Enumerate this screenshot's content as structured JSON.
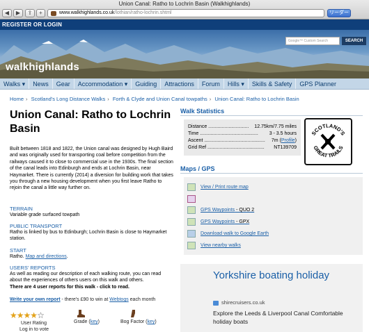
{
  "browser": {
    "title": "Union Canal: Ratho to Lochrin Basin (Walkhighlands)",
    "url_host": "www.walkhighlands.co.uk",
    "url_path": "/lothian/ratho-lochrin.shtml",
    "reader_label": "リーダー",
    "plus_label": "+"
  },
  "header": {
    "register_login": "REGISTER OR LOGIN",
    "logo": "walkhighlands",
    "search_placeholder": "Google™ Custom Search",
    "search_button": "SEARCH"
  },
  "nav": {
    "items": [
      "Walks ▾",
      "News",
      "Gear",
      "Accommodation ▾",
      "Guiding",
      "Attractions",
      "Forum",
      "Hills ▾",
      "Skills & Safety",
      "GPS Planner"
    ]
  },
  "breadcrumb": [
    "Home",
    "Scotland's Long Distance Walks",
    "Forth & Clyde and Union Canal towpaths",
    "Union Canal: Ratho to Lochrin Basin"
  ],
  "main": {
    "title": "Union Canal: Ratho to Lochrin Basin",
    "intro": "Built between 1818 and 1822, the Union canal was designed by Hugh Baird and was originally used for transporting coal before competition from the railways caused it to close to commercial use in the 1930s. The final section of the canal leads into Edinburgh and ends at Lochrin Basin, near Haymarket. There is currently (2014) a diversion for building work that takes you through a new housing development when you first leave Ratho to rejoin the canal a little way further on.",
    "terrain_head": "TERRAIN",
    "terrain_text": "Variable grade surfaced towpath",
    "transport_head": "PUBLIC TRANSPORT",
    "transport_text": "Ratho is linked by bus to Edinburgh; Lochrin Basin is close to Haymarket station.",
    "start_head": "START",
    "start_text": "Ratho.",
    "start_link": "Map and directions",
    "start_end": ".",
    "reports_head": "USERS' REPORTS",
    "reports_text": "As well as reading our description of each walking route, you can read about the experiences of others users on this walk and others.",
    "reports_bold": "There are 4 user reports for this walk - click to read.",
    "write_link": "Write your own report",
    "write_mid": " - there's £90 to win at ",
    "write_webtogs": "Webtogs",
    "write_end": " each month",
    "rating_label": "User Rating",
    "login_label": "Log in to vote",
    "grade_label": "Grade (",
    "grade_key": "key",
    "grade_end": ")",
    "bog_label": "Bog Factor (",
    "bog_key": "key",
    "bog_end": ")",
    "user_rating": 3.5,
    "rating_stars": [
      "★",
      "★",
      "★",
      "★",
      "☆"
    ]
  },
  "stats": {
    "title": "Walk Statistics",
    "distance_label": "Distance ..............................",
    "distance_value": "12.75km/7.75 miles",
    "time_label": "Time ...........................................",
    "time_value": "3 - 3.5 hours",
    "ascent_label": "Ascent .............................................",
    "ascent_value": "7m (",
    "ascent_profile": "Profile",
    "ascent_end": ")",
    "gridref_label": "Grid Ref ..........................................",
    "gridref_value": "NT139709",
    "badge_top": "SCOTLAND'S",
    "badge_bottom": "GREAT TRAILS"
  },
  "maps": {
    "title": "Maps / GPS",
    "links": [
      {
        "label": "View / Print route map",
        "suffix": ""
      },
      {
        "label": "",
        "suffix": ""
      },
      {
        "label": "GPS Waypoints",
        "suffix": " - QUO 2"
      },
      {
        "label": "GPS Waypoints",
        "suffix": " - GPX"
      },
      {
        "label": "Download walk to Google Earth",
        "suffix": ""
      },
      {
        "label": "View nearby walks",
        "suffix": ""
      }
    ]
  },
  "ad": {
    "title": "Yorkshire boating holiday",
    "domain": "shirecruisers.co.uk",
    "text": "Explore the Leeds & Liverpool Canal Comfortable holiday boats"
  },
  "colors": {
    "link": "#1a5fa7",
    "header_blue": "#0f3f7a",
    "nav_bg": "#c3d6e7",
    "star": "#e3a21a"
  }
}
